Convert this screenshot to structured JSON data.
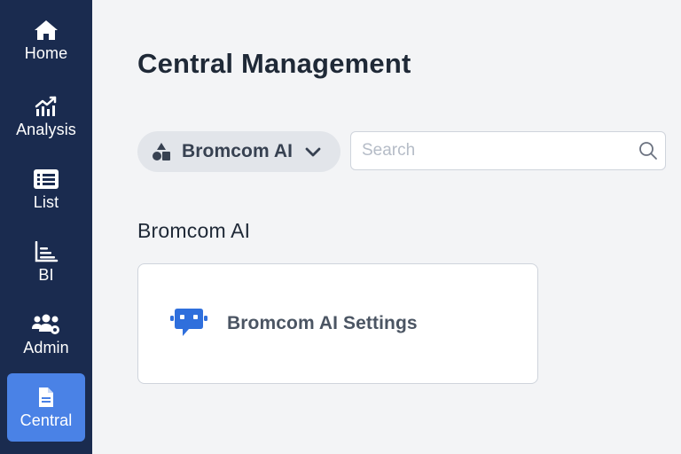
{
  "sidebar": {
    "items": [
      {
        "label": "Home",
        "icon": "home-icon",
        "active": false
      },
      {
        "label": "Analysis",
        "icon": "analysis-icon",
        "active": false
      },
      {
        "label": "List",
        "icon": "list-icon",
        "active": false
      },
      {
        "label": "BI",
        "icon": "bi-chart-icon",
        "active": false
      },
      {
        "label": "Admin",
        "icon": "admin-users-icon",
        "active": false
      },
      {
        "label": "Central",
        "icon": "document-icon",
        "active": true
      }
    ]
  },
  "main": {
    "title": "Central Management",
    "selector": {
      "label": "Bromcom AI",
      "icon": "shapes-icon"
    },
    "search": {
      "placeholder": "Search",
      "value": ""
    },
    "section": {
      "title": "Bromcom AI",
      "cards": [
        {
          "label": "Bromcom AI Settings",
          "icon": "robot-chat-icon"
        }
      ]
    }
  },
  "colors": {
    "sidebar_bg": "#1a2b4f",
    "active_bg": "#4a82e6",
    "page_bg": "#f3f4f6",
    "accent": "#2f6fdc"
  }
}
